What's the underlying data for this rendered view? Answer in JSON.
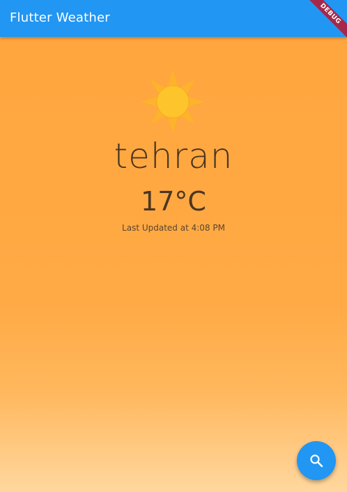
{
  "app_bar": {
    "title": "Flutter Weather",
    "color": "#2196F3"
  },
  "debug_banner": {
    "label": "DEBUG",
    "color": "#A5284B"
  },
  "weather": {
    "condition_icon": "sun-icon",
    "city": "tehran",
    "temperature": "17°C",
    "last_updated": "Last Updated at 4:08 PM"
  },
  "fab": {
    "icon": "search-icon",
    "color": "#2196F3"
  },
  "background": {
    "top_color": "#FFA53D",
    "bottom_color": "#FFD79F"
  }
}
